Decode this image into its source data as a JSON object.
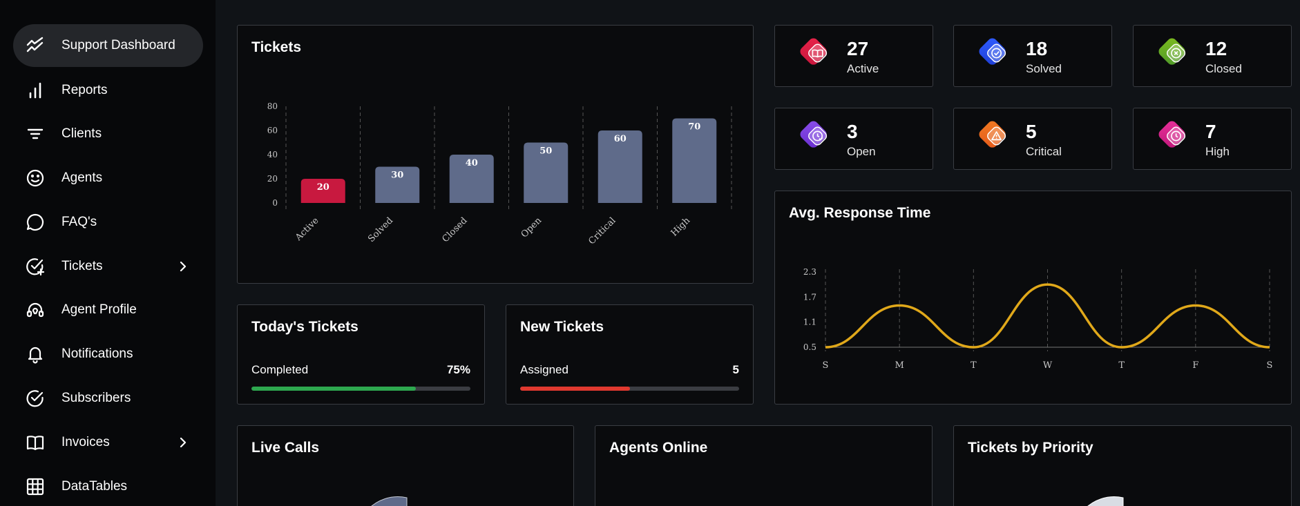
{
  "sidebar": {
    "items": [
      {
        "label": "Support Dashboard",
        "icon": "trending-icon",
        "active": true
      },
      {
        "label": "Reports",
        "icon": "bar-chart-icon"
      },
      {
        "label": "Clients",
        "icon": "filter-icon"
      },
      {
        "label": "Agents",
        "icon": "smiley-icon"
      },
      {
        "label": "FAQ's",
        "icon": "chat-bubble-icon"
      },
      {
        "label": "Tickets",
        "icon": "check-circle-plus-icon",
        "has_submenu": true
      },
      {
        "label": "Agent Profile",
        "icon": "headset-icon"
      },
      {
        "label": "Notifications",
        "icon": "bell-icon"
      },
      {
        "label": "Subscribers",
        "icon": "check-circle-icon"
      },
      {
        "label": "Invoices",
        "icon": "book-icon",
        "has_submenu": true
      },
      {
        "label": "DataTables",
        "icon": "grid-icon"
      }
    ]
  },
  "tickets_chart": {
    "title": "Tickets"
  },
  "stats": [
    {
      "value": "27",
      "label": "Active",
      "icon": "book-icon",
      "colors": [
        "#e8234a",
        "#c8163c"
      ]
    },
    {
      "value": "18",
      "label": "Solved",
      "icon": "check-circle-icon",
      "colors": [
        "#2f5cff",
        "#1f3fd6"
      ]
    },
    {
      "value": "12",
      "label": "Closed",
      "icon": "x-circle-icon",
      "colors": [
        "#7dbb1e",
        "#4f9a2a"
      ]
    },
    {
      "value": "3",
      "label": "Open",
      "icon": "clock-check-icon",
      "colors": [
        "#8a4dea",
        "#6a2fd0"
      ]
    },
    {
      "value": "5",
      "label": "Critical",
      "icon": "warning-icon",
      "colors": [
        "#f07a22",
        "#e45a1b"
      ]
    },
    {
      "value": "7",
      "label": "High",
      "icon": "clock-icon",
      "colors": [
        "#e8309a",
        "#c0187a"
      ]
    }
  ],
  "today_tickets": {
    "title": "Today's Tickets",
    "label": "Completed",
    "value": "75%",
    "fraction": 0.75,
    "color": "#2ea84f"
  },
  "new_tickets": {
    "title": "New Tickets",
    "label": "Assigned",
    "value": "5",
    "fraction": 0.5,
    "color": "#e0392f"
  },
  "response_chart": {
    "title": "Avg. Response Time"
  },
  "bottom_cards": {
    "live_calls": "Live Calls",
    "agents_online": "Agents Online",
    "tickets_by_priority": "Tickets by Priority"
  },
  "colors": {
    "accent_red": "#c8193f",
    "bar": "#5f6b8a",
    "line": "#e0a81a"
  },
  "chart_data": [
    {
      "type": "bar",
      "title": "Tickets",
      "categories": [
        "Active",
        "Solved",
        "Closed",
        "Open",
        "Critical",
        "High"
      ],
      "values": [
        20,
        30,
        40,
        50,
        60,
        70
      ],
      "yticks": [
        "0",
        "20",
        "40",
        "60",
        "80"
      ],
      "ylim": [
        0,
        80
      ],
      "grid": true
    },
    {
      "type": "line",
      "title": "Avg. Response Time",
      "x": [
        "S",
        "M",
        "T",
        "W",
        "T",
        "F",
        "S"
      ],
      "series": [
        {
          "values": [
            0.5,
            1.5,
            0.5,
            2.0,
            0.5,
            1.5,
            0.5
          ]
        }
      ],
      "yticks": [
        "0.5",
        "1.1",
        "1.7",
        "2.3"
      ],
      "ylim": [
        0.5,
        2.3
      ],
      "grid": true
    }
  ]
}
